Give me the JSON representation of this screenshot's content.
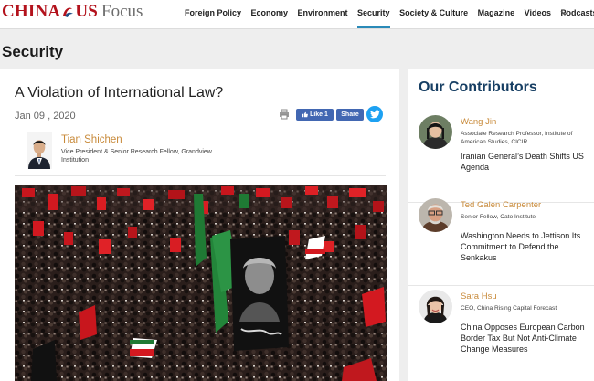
{
  "brand": {
    "logo_china": "CHINA",
    "logo_us": "US",
    "logo_focus": "Focus",
    "accent_red": "#b3121c",
    "accent_blue": "#2a8ab8",
    "heading_navy": "#163e63",
    "name_gold": "#c88a3a"
  },
  "nav": {
    "items": [
      {
        "label": "Foreign Policy"
      },
      {
        "label": "Economy"
      },
      {
        "label": "Environment"
      },
      {
        "label": "Security",
        "active": true
      },
      {
        "label": "Society & Culture"
      },
      {
        "label": "Magazine"
      },
      {
        "label": "Videos"
      },
      {
        "label": "Podcasts"
      }
    ],
    "more_icon": "chevron-down-icon"
  },
  "page": {
    "section_title": "Security"
  },
  "article": {
    "headline": "A Violation of International Law?",
    "date": "Jan 09 , 2020",
    "share": {
      "print_icon": "print-icon",
      "like_label": "Like 1",
      "share_label": "Share",
      "twitter_icon": "twitter-icon"
    },
    "author": {
      "name": "Tian Shichen",
      "title": "Vice President & Senior Research Fellow, Grandview Institution"
    },
    "hero_image": "crowd-with-banner-photo"
  },
  "contributors": {
    "heading": "Our Contributors",
    "items": [
      {
        "name": "Wang Jin",
        "title": "Associate Research Professor, Institute of American Studies, CICIR",
        "article": "Iranian General’s Death Shifts US Agenda"
      },
      {
        "name": "Ted Galen Carpenter",
        "title": "Senior Fellow, Cato Institute",
        "article": "Washington Needs to Jettison Its Commitment to Defend the Senkakus"
      },
      {
        "name": "Sara Hsu",
        "title": "CEO, China Rising Capital Forecast",
        "article": "China Opposes European Carbon Border Tax But Not Anti-Climate Change Measures"
      }
    ]
  }
}
